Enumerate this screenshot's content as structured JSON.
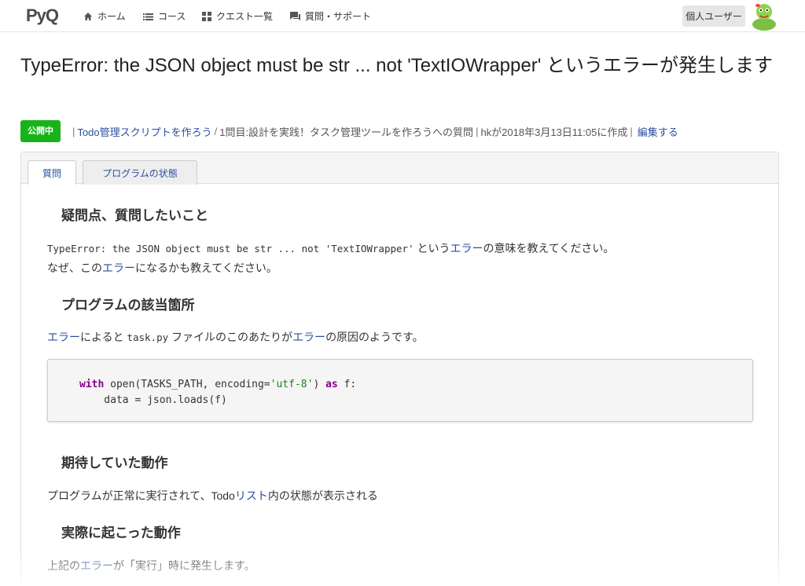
{
  "nav": {
    "logo": "PyQ",
    "items": [
      {
        "label": "ホーム",
        "icon": "home-icon"
      },
      {
        "label": "コース",
        "icon": "list-icon"
      },
      {
        "label": "クエスト一覧",
        "icon": "grid-icon"
      },
      {
        "label": "質問・サポート",
        "icon": "chat-icon"
      }
    ],
    "user_label": "個人ユーザー",
    "avatar_icon": "snake-mascot-icon"
  },
  "title": "TypeError: the JSON object must be str ... not 'TextIOWrapper' というエラーが発生します",
  "meta": {
    "status_badge": "公開中",
    "course_link": "Todo管理スクリプトを作ろう",
    "breadcrumb_rest": "1問目:設計を実践！タスク管理ツールを作ろうへの質問",
    "author_info": "hkが2018年3月13日11:05に作成",
    "edit_link": "編集する",
    "status_color": "#18b31a",
    "link_color": "#2a4f9f"
  },
  "tabs": [
    {
      "label": "質問",
      "active": true
    },
    {
      "label": "プログラムの状態",
      "active": false
    }
  ],
  "sections": {
    "question_heading": "疑問点、質問したいこと",
    "question_code": "TypeError: the JSON object must be str ... not 'TextIOWrapper'",
    "question_text_1": " という",
    "question_link_1": "エラー",
    "question_text_2": "の意味を教えてください。",
    "question_line2_a": "なぜ、この",
    "question_line2_link": "エラー",
    "question_line2_b": "になるかも教えてください。",
    "program_heading": "プログラムの該当箇所",
    "program_link_1": "エラー",
    "program_text_1": "によると ",
    "program_code": "task.py",
    "program_text_2": " ファイルのこのあたりが",
    "program_link_2": "エラー",
    "program_text_3": "の原因のようです。",
    "code_line1_kw": "with",
    "code_line1_a": " open(TASKS_PATH, encoding=",
    "code_line1_str": "'utf-8'",
    "code_line1_b": ") ",
    "code_line1_kw2": "as",
    "code_line1_c": " f:",
    "code_line2": "    data = json.loads(f)",
    "expected_heading": "期待していた動作",
    "expected_text_a": "プログラムが正常に実行されて、Todo",
    "expected_link": "リスト",
    "expected_text_b": "内の状態が表示される",
    "actual_heading": "実際に起こった動作",
    "actual_text_a": "上記の",
    "actual_link": "エラー",
    "actual_text_b": "が「実行」時に発生します。"
  }
}
